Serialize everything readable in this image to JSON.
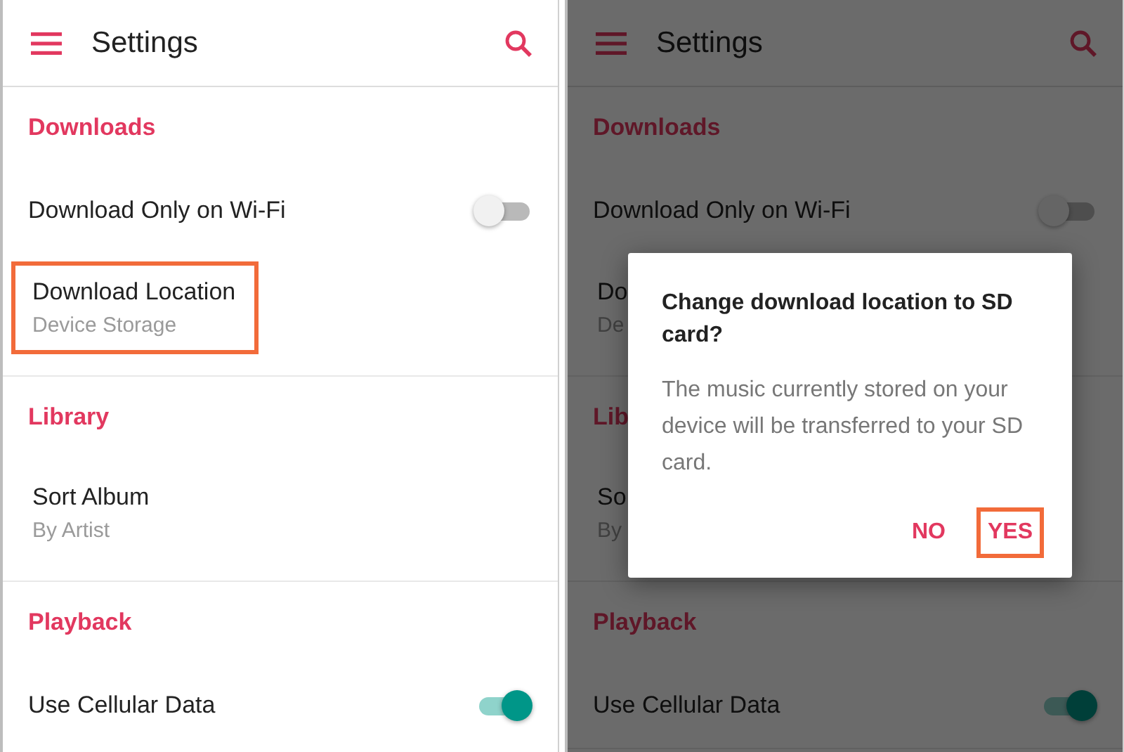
{
  "screens": [
    {
      "dimmed": false,
      "app_bar": {
        "title": "Settings"
      },
      "sections": [
        {
          "title": "Downloads",
          "items": [
            {
              "kind": "toggle",
              "label": "Download Only on Wi-Fi",
              "on": false
            },
            {
              "kind": "choice",
              "label": "Download Location",
              "value": "Device Storage",
              "highlighted": true
            }
          ]
        },
        {
          "title": "Library",
          "items": [
            {
              "kind": "choice",
              "label": "Sort Album",
              "value": "By Artist"
            }
          ]
        },
        {
          "title": "Playback",
          "items": [
            {
              "kind": "toggle",
              "label": "Use Cellular Data",
              "on": true
            }
          ]
        }
      ]
    },
    {
      "dimmed": true,
      "app_bar": {
        "title": "Settings"
      },
      "sections": [
        {
          "title": "Downloads",
          "items": [
            {
              "kind": "toggle",
              "label": "Download Only on Wi-Fi",
              "on": false
            },
            {
              "kind": "choice",
              "label": "Do",
              "value": "De"
            }
          ]
        },
        {
          "title": "Lib",
          "items": [
            {
              "kind": "choice",
              "label": "So",
              "value": "By"
            }
          ]
        },
        {
          "title": "Playback",
          "items": [
            {
              "kind": "toggle",
              "label": "Use Cellular Data",
              "on": true
            }
          ]
        }
      ],
      "dialog": {
        "title": "Change download location to SD card?",
        "message": "The music currently stored on your device will be transferred to your SD card.",
        "buttons": [
          {
            "label": "NO"
          },
          {
            "label": "YES",
            "highlighted": true
          }
        ]
      }
    }
  ]
}
